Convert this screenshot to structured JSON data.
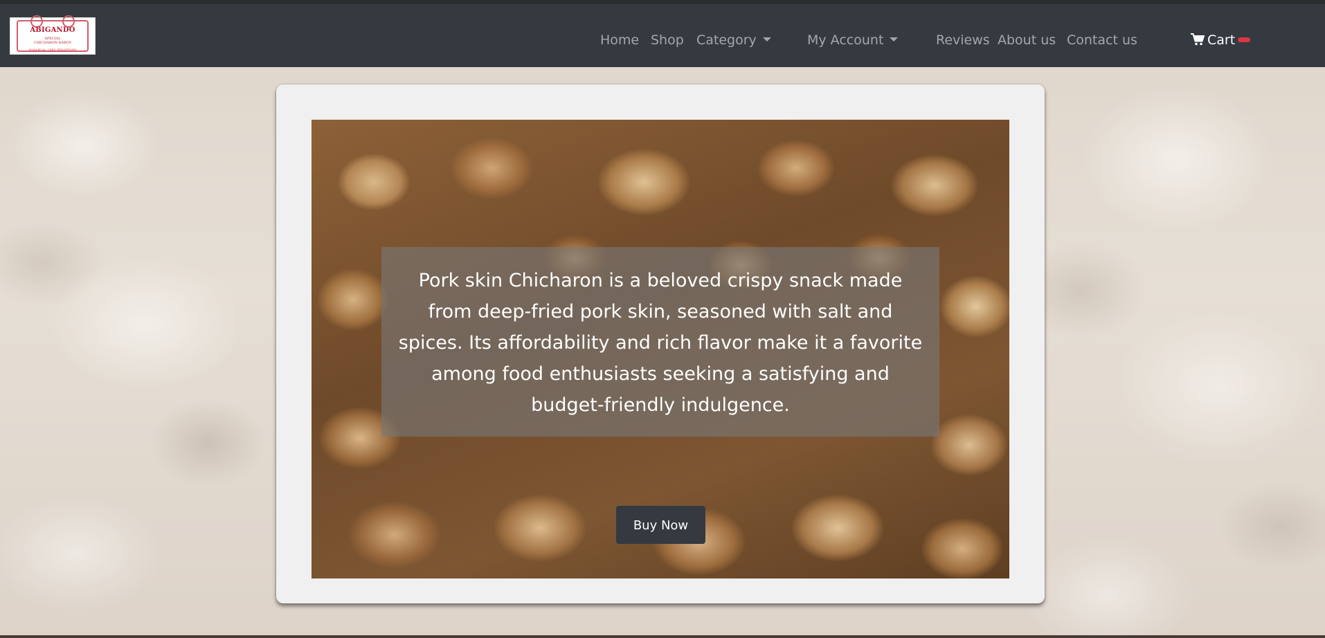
{
  "brand": {
    "name": "ABIGANDO",
    "subtitle_line1": "SPECIAL",
    "subtitle_line2": "CHICHARON BABOY",
    "footer": "MOALBOAL, CEBU PHILIPPINES"
  },
  "navbar": {
    "items": [
      {
        "label": "Home"
      },
      {
        "label": "Shop"
      },
      {
        "label": "Category",
        "dropdown": true
      },
      {
        "label": "My Account",
        "dropdown": true
      },
      {
        "label": "Reviews"
      },
      {
        "label": "About us"
      },
      {
        "label": "Contact us"
      }
    ],
    "cart": {
      "label": "Cart",
      "icon": "cart-icon",
      "badge_color": "#dc3545"
    }
  },
  "hero": {
    "caption": "Pork skin Chicharon is a beloved crispy snack made from deep-fried pork skin, seasoned with salt and spices. Its affordability and rich flavor make it a favorite among food enthusiasts seeking a satisfying and budget-friendly indulgence.",
    "button_label": "Buy Now"
  },
  "colors": {
    "navbar_bg": "#343a40",
    "card_bg": "#f0f0f0",
    "button_bg": "#343a40"
  }
}
